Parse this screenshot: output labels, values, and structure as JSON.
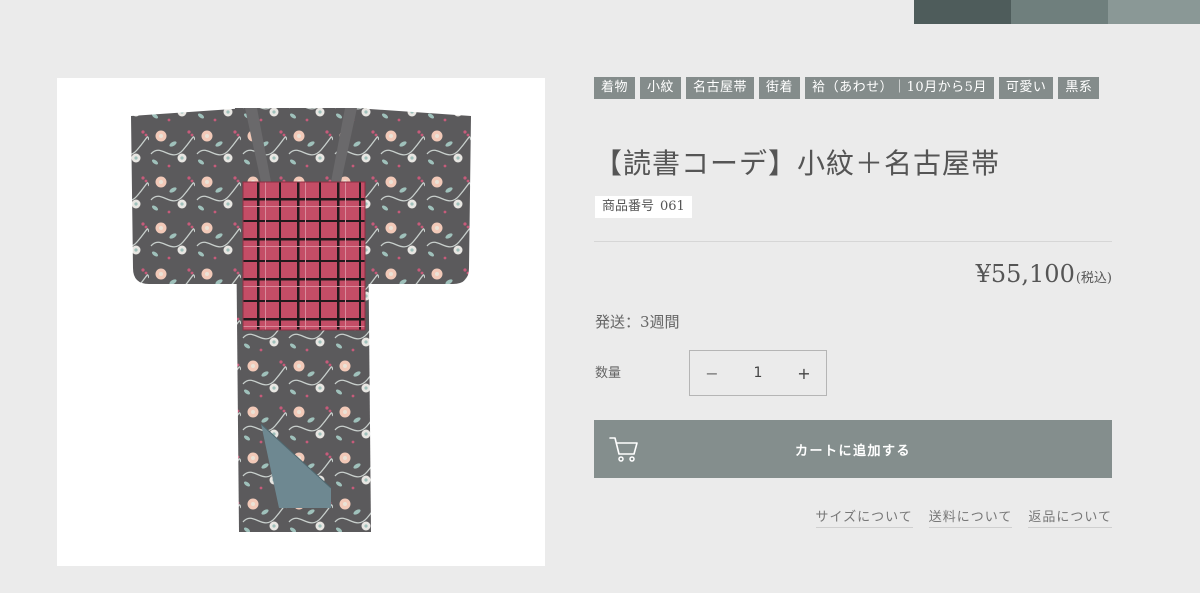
{
  "header": {
    "swatch_colors": [
      "#4e5c5b",
      "#6f7f7d",
      "#8a9896"
    ]
  },
  "product": {
    "tags": [
      "着物",
      "小紋",
      "名古屋帯",
      "街着",
      "袷（あわせ）｜10月から5月",
      "可愛い",
      "黒系"
    ],
    "title": "【読書コーデ】小紋＋名古屋帯",
    "sku_label": "商品番号",
    "sku_value": "061",
    "price": "¥55,100",
    "price_tax_note": "(税込)",
    "shipping": "発送：3週間",
    "quantity_label": "数量",
    "quantity_value": "1",
    "quantity_minus": "−",
    "quantity_plus": "+",
    "cart_button": "カートに追加する",
    "cart_icon": "shopping-cart-icon",
    "info_links": [
      "サイズについて",
      "送料について",
      "返品について"
    ],
    "image_icon": "kimono-product-photo",
    "colors": {
      "kimono_body": "#5b5a5c",
      "obi": "#c44d66",
      "obi_stripes": "#1f1a1c",
      "lining": "#6e8891",
      "tag_bg": "#848c8b",
      "cart_bg": "#848e8d"
    }
  }
}
